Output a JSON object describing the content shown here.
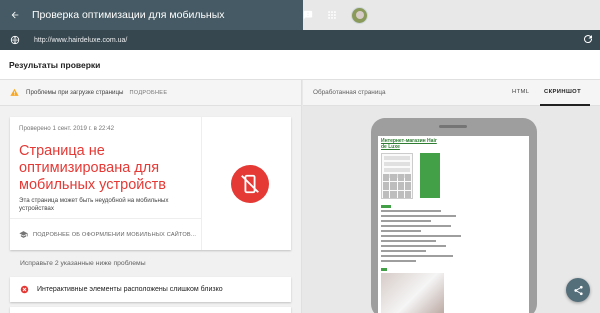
{
  "appbar": {
    "title": "Проверка оптимизации для мобильных",
    "back_icon": "arrow-back-icon",
    "icons": [
      "feedback-icon",
      "apps-grid-icon",
      "avatar"
    ]
  },
  "urlbar": {
    "url": "http://www.hairdeluxe.com.ua/",
    "globe_icon": "globe-icon",
    "reload_icon": "reload-icon"
  },
  "results": {
    "title": "Результаты проверки"
  },
  "warning": {
    "text": "Проблемы при загрузке страницы",
    "link": "ПОДРОБНЕЕ"
  },
  "verdict_card": {
    "date": "Проверено 1 сент. 2019 г. в 22:42",
    "verdict": "Страница не оптимизирована для мобильных устройств",
    "description": "Эта страница может быть неудобной на мобильных устройствах",
    "more_link": "ПОДРОБНЕЕ ОБ ОФОРМЛЕНИИ МОБИЛЬНЫХ САЙТОВ..."
  },
  "issues": {
    "hint": "Исправьте 2 указанные ниже проблемы",
    "items": [
      "Интерактивные элементы расположены слишком близко"
    ]
  },
  "preview": {
    "label": "Обработанная страница",
    "tabs": [
      "HTML",
      "СКРИНШОТ"
    ],
    "active_tab": "СКРИНШОТ",
    "mobile_title": "Интернет-магазин Hair de Luxe"
  },
  "colors": {
    "appbar": "#455a64",
    "urlbar": "#37474f",
    "error": "#e53935",
    "warning": "#f9a825",
    "site_green": "#43a047"
  }
}
